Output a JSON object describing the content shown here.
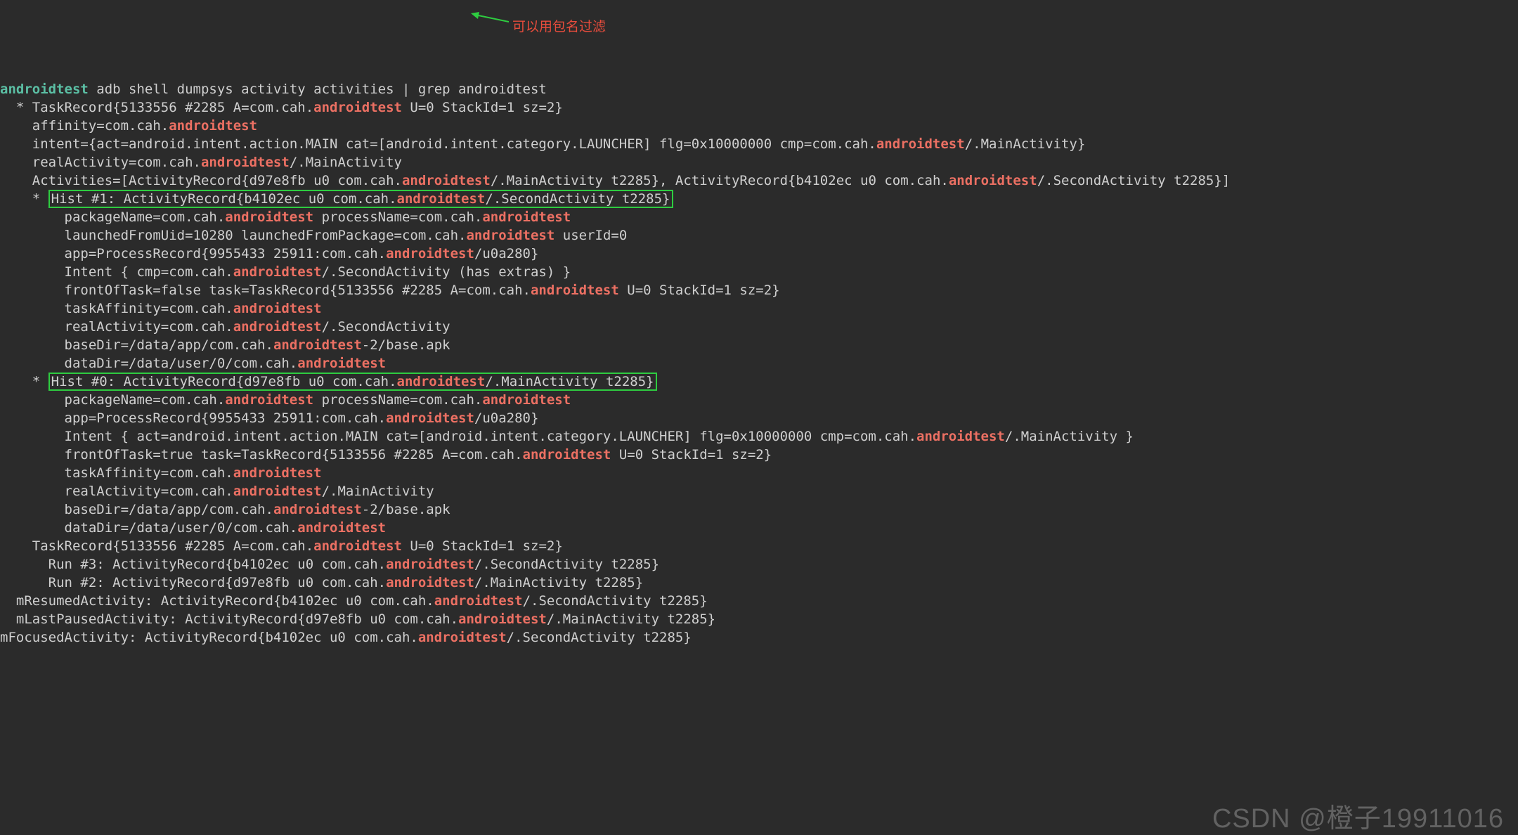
{
  "prompt": "androidtest",
  "command": " adb shell dumpsys activity activities | grep androidtest",
  "annotation": "可以用包名过滤",
  "watermark": "CSDN @橙子19911016",
  "hl": "androidtest",
  "lines": [
    {
      "indent": "  ",
      "pre": "* TaskRecord{5133556 #2285 A=com.cah.",
      "post": " U=0 StackId=1 sz=2}",
      "hl": 1
    },
    {
      "indent": "    ",
      "pre": "affinity=com.cah.",
      "post": "",
      "hl": 1
    },
    {
      "indent": "    ",
      "pre": "intent={act=android.intent.action.MAIN cat=[android.intent.category.LAUNCHER] flg=0x10000000 cmp=com.cah.",
      "post": "/.MainActivity}",
      "hl": 1
    },
    {
      "indent": "    ",
      "pre": "realActivity=com.cah.",
      "post": "/.MainActivity",
      "hl": 1
    },
    {
      "indent": "    ",
      "pre": "Activities=[ActivityRecord{d97e8fb u0 com.cah.",
      "mid": "/.MainActivity t2285}, ActivityRecord{b4102ec u0 com.cah.",
      "post": "/.SecondActivity t2285}]",
      "hl": 2
    },
    {
      "indent": "    ",
      "boxed": true,
      "star": "* ",
      "pre": "Hist #1: ActivityRecord{b4102ec u0 com.cah.",
      "post": "/.SecondActivity t2285}",
      "hl": 1
    },
    {
      "indent": "        ",
      "pre": "packageName=com.cah.",
      "mid": " processName=com.cah.",
      "post": "",
      "hl": 2
    },
    {
      "indent": "        ",
      "pre": "launchedFromUid=10280 launchedFromPackage=com.cah.",
      "post": " userId=0",
      "hl": 1
    },
    {
      "indent": "        ",
      "pre": "app=ProcessRecord{9955433 25911:com.cah.",
      "post": "/u0a280}",
      "hl": 1
    },
    {
      "indent": "        ",
      "pre": "Intent { cmp=com.cah.",
      "post": "/.SecondActivity (has extras) }",
      "hl": 1
    },
    {
      "indent": "        ",
      "pre": "frontOfTask=false task=TaskRecord{5133556 #2285 A=com.cah.",
      "post": " U=0 StackId=1 sz=2}",
      "hl": 1
    },
    {
      "indent": "        ",
      "pre": "taskAffinity=com.cah.",
      "post": "",
      "hl": 1
    },
    {
      "indent": "        ",
      "pre": "realActivity=com.cah.",
      "post": "/.SecondActivity",
      "hl": 1
    },
    {
      "indent": "        ",
      "pre": "baseDir=/data/app/com.cah.",
      "post": "-2/base.apk",
      "hl": 1
    },
    {
      "indent": "        ",
      "pre": "dataDir=/data/user/0/com.cah.",
      "post": "",
      "hl": 1
    },
    {
      "indent": "    ",
      "boxed": true,
      "star": "* ",
      "pre": "Hist #0: ActivityRecord{d97e8fb u0 com.cah.",
      "post": "/.MainActivity t2285}",
      "hl": 1
    },
    {
      "indent": "        ",
      "pre": "packageName=com.cah.",
      "mid": " processName=com.cah.",
      "post": "",
      "hl": 2
    },
    {
      "indent": "        ",
      "pre": "app=ProcessRecord{9955433 25911:com.cah.",
      "post": "/u0a280}",
      "hl": 1
    },
    {
      "indent": "        ",
      "pre": "Intent { act=android.intent.action.MAIN cat=[android.intent.category.LAUNCHER] flg=0x10000000 cmp=com.cah.",
      "post": "/.MainActivity }",
      "hl": 1
    },
    {
      "indent": "        ",
      "pre": "frontOfTask=true task=TaskRecord{5133556 #2285 A=com.cah.",
      "post": " U=0 StackId=1 sz=2}",
      "hl": 1
    },
    {
      "indent": "        ",
      "pre": "taskAffinity=com.cah.",
      "post": "",
      "hl": 1
    },
    {
      "indent": "        ",
      "pre": "realActivity=com.cah.",
      "post": "/.MainActivity",
      "hl": 1
    },
    {
      "indent": "        ",
      "pre": "baseDir=/data/app/com.cah.",
      "post": "-2/base.apk",
      "hl": 1
    },
    {
      "indent": "        ",
      "pre": "dataDir=/data/user/0/com.cah.",
      "post": "",
      "hl": 1
    },
    {
      "indent": "    ",
      "pre": "TaskRecord{5133556 #2285 A=com.cah.",
      "post": " U=0 StackId=1 sz=2}",
      "hl": 1
    },
    {
      "indent": "      ",
      "pre": "Run #3: ActivityRecord{b4102ec u0 com.cah.",
      "post": "/.SecondActivity t2285}",
      "hl": 1
    },
    {
      "indent": "      ",
      "pre": "Run #2: ActivityRecord{d97e8fb u0 com.cah.",
      "post": "/.MainActivity t2285}",
      "hl": 1
    },
    {
      "indent": "  ",
      "pre": "mResumedActivity: ActivityRecord{b4102ec u0 com.cah.",
      "post": "/.SecondActivity t2285}",
      "hl": 1
    },
    {
      "indent": "  ",
      "pre": "mLastPausedActivity: ActivityRecord{d97e8fb u0 com.cah.",
      "post": "/.MainActivity t2285}",
      "hl": 1
    },
    {
      "indent": "",
      "pre": "mFocusedActivity: ActivityRecord{b4102ec u0 com.cah.",
      "post": "/.SecondActivity t2285}",
      "hl": 1
    }
  ]
}
